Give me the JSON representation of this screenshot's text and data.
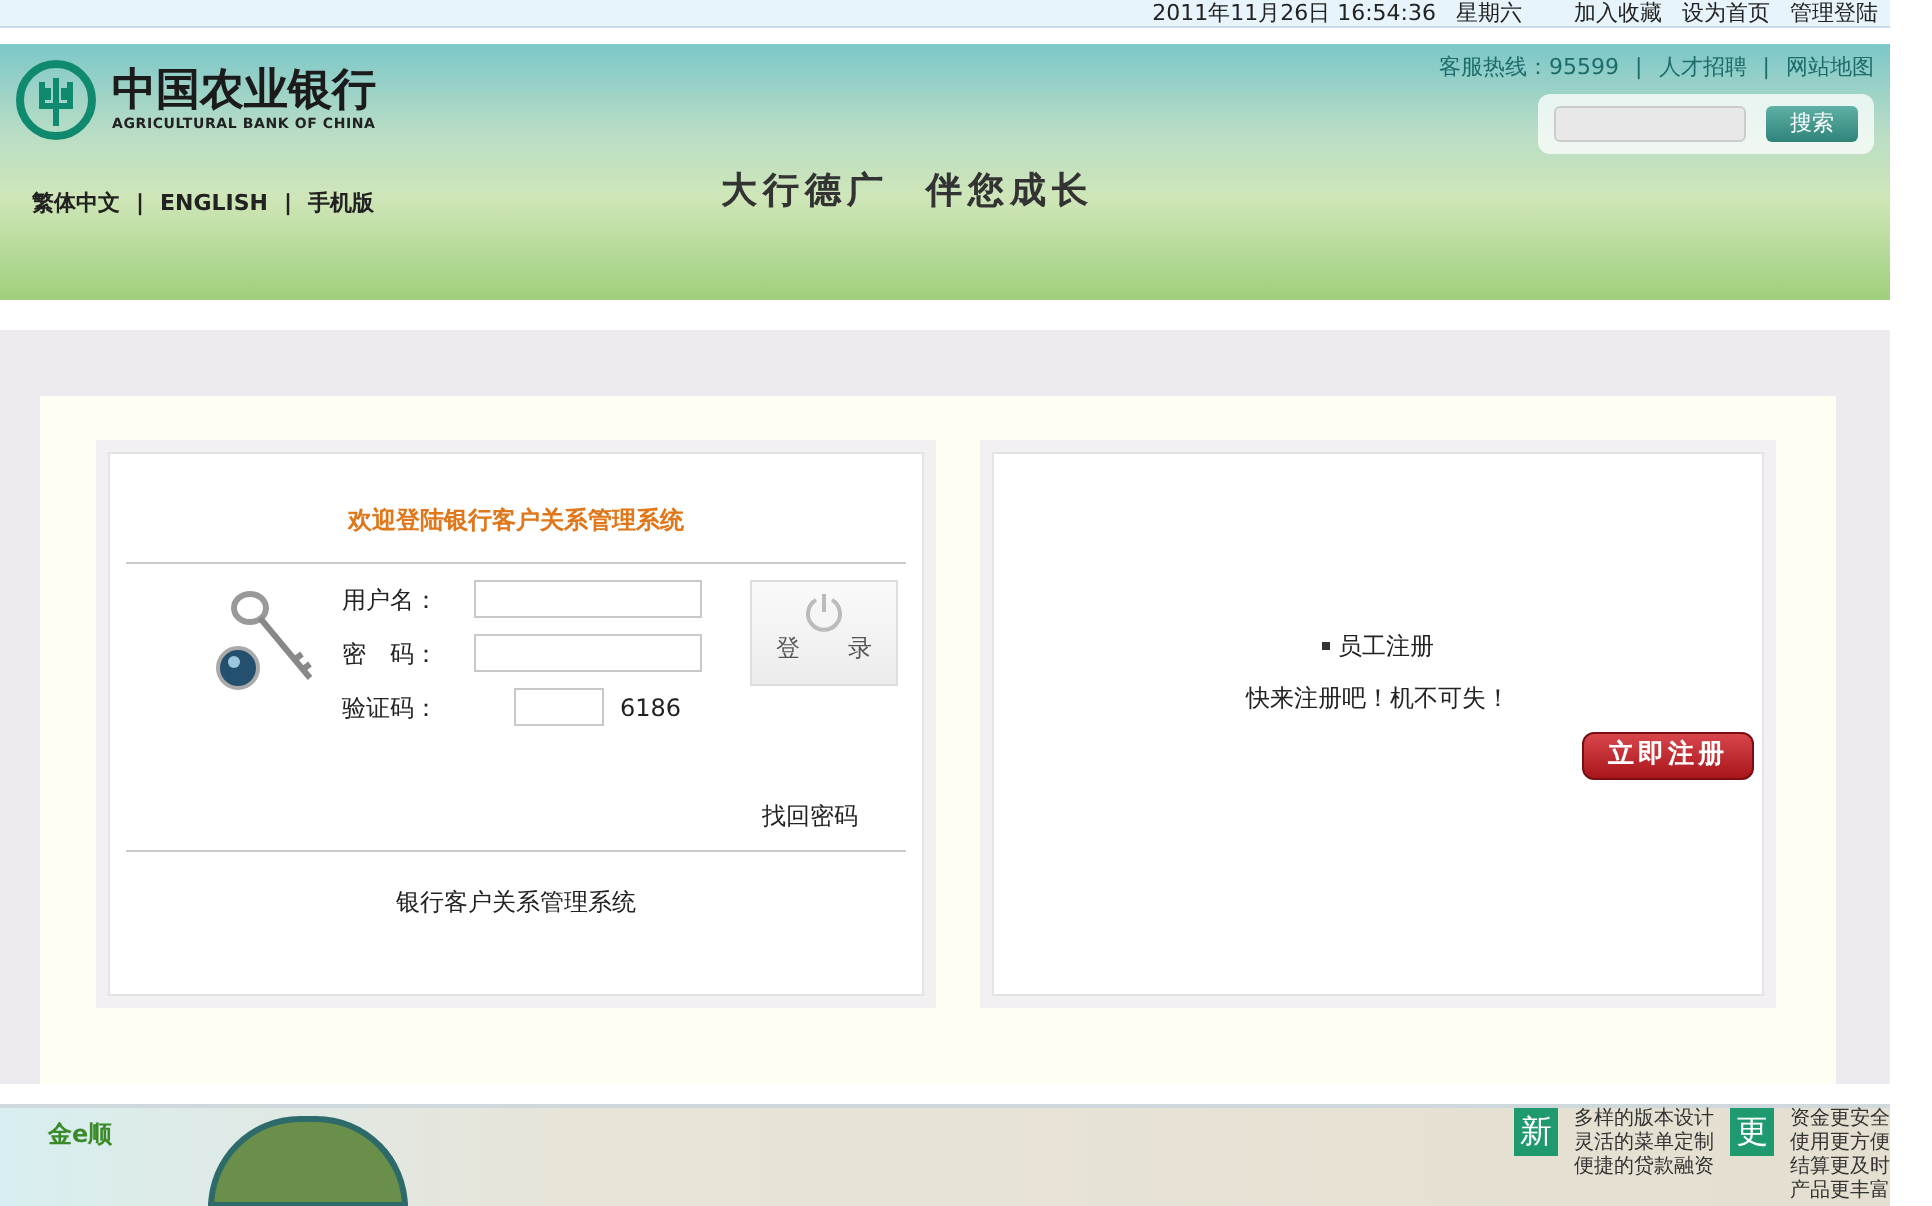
{
  "top_bar": {
    "datetime": "2011年11月26日 16:54:36",
    "weekday": "星期六",
    "links": [
      "加入收藏",
      "设为首页",
      "管理登陆"
    ]
  },
  "header": {
    "logo_name": "中国农业银行",
    "logo_english": "AGRICULTURAL BANK OF CHINA",
    "languages": [
      "繁体中文",
      "ENGLISH",
      "手机版"
    ],
    "language_separators": [
      "|",
      "|"
    ],
    "slogan": "大行德广  伴您成长",
    "service_links": [
      "客服热线：95599",
      "人才招聘",
      "网站地图"
    ],
    "service_separators": [
      "|",
      "|"
    ],
    "search": {
      "button": "搜索"
    }
  },
  "login": {
    "title": "欢迎登陆银行客户关系管理系统",
    "fields": [
      {
        "label": "用户名：",
        "kind": "text"
      },
      {
        "label": "密　码：",
        "kind": "password"
      },
      {
        "label": "验证码：",
        "kind": "captcha",
        "code": "6186"
      }
    ],
    "login_button": "登　　录",
    "recover_link": "找回密码",
    "footer": "银行客户关系管理系统"
  },
  "register": {
    "heading": "员工注册",
    "text": "快来注册吧！机不可失！",
    "button": "立即注册"
  },
  "banner": {
    "brand": "金e顺",
    "badge_1": "新",
    "lines_1": [
      "多样的版本设计",
      "灵活的菜单定制",
      "便捷的贷款融资"
    ],
    "badge_2": "更",
    "lines_2": [
      "资金更安全",
      "使用更方便",
      "结算更及时",
      "产品更丰富"
    ]
  }
}
